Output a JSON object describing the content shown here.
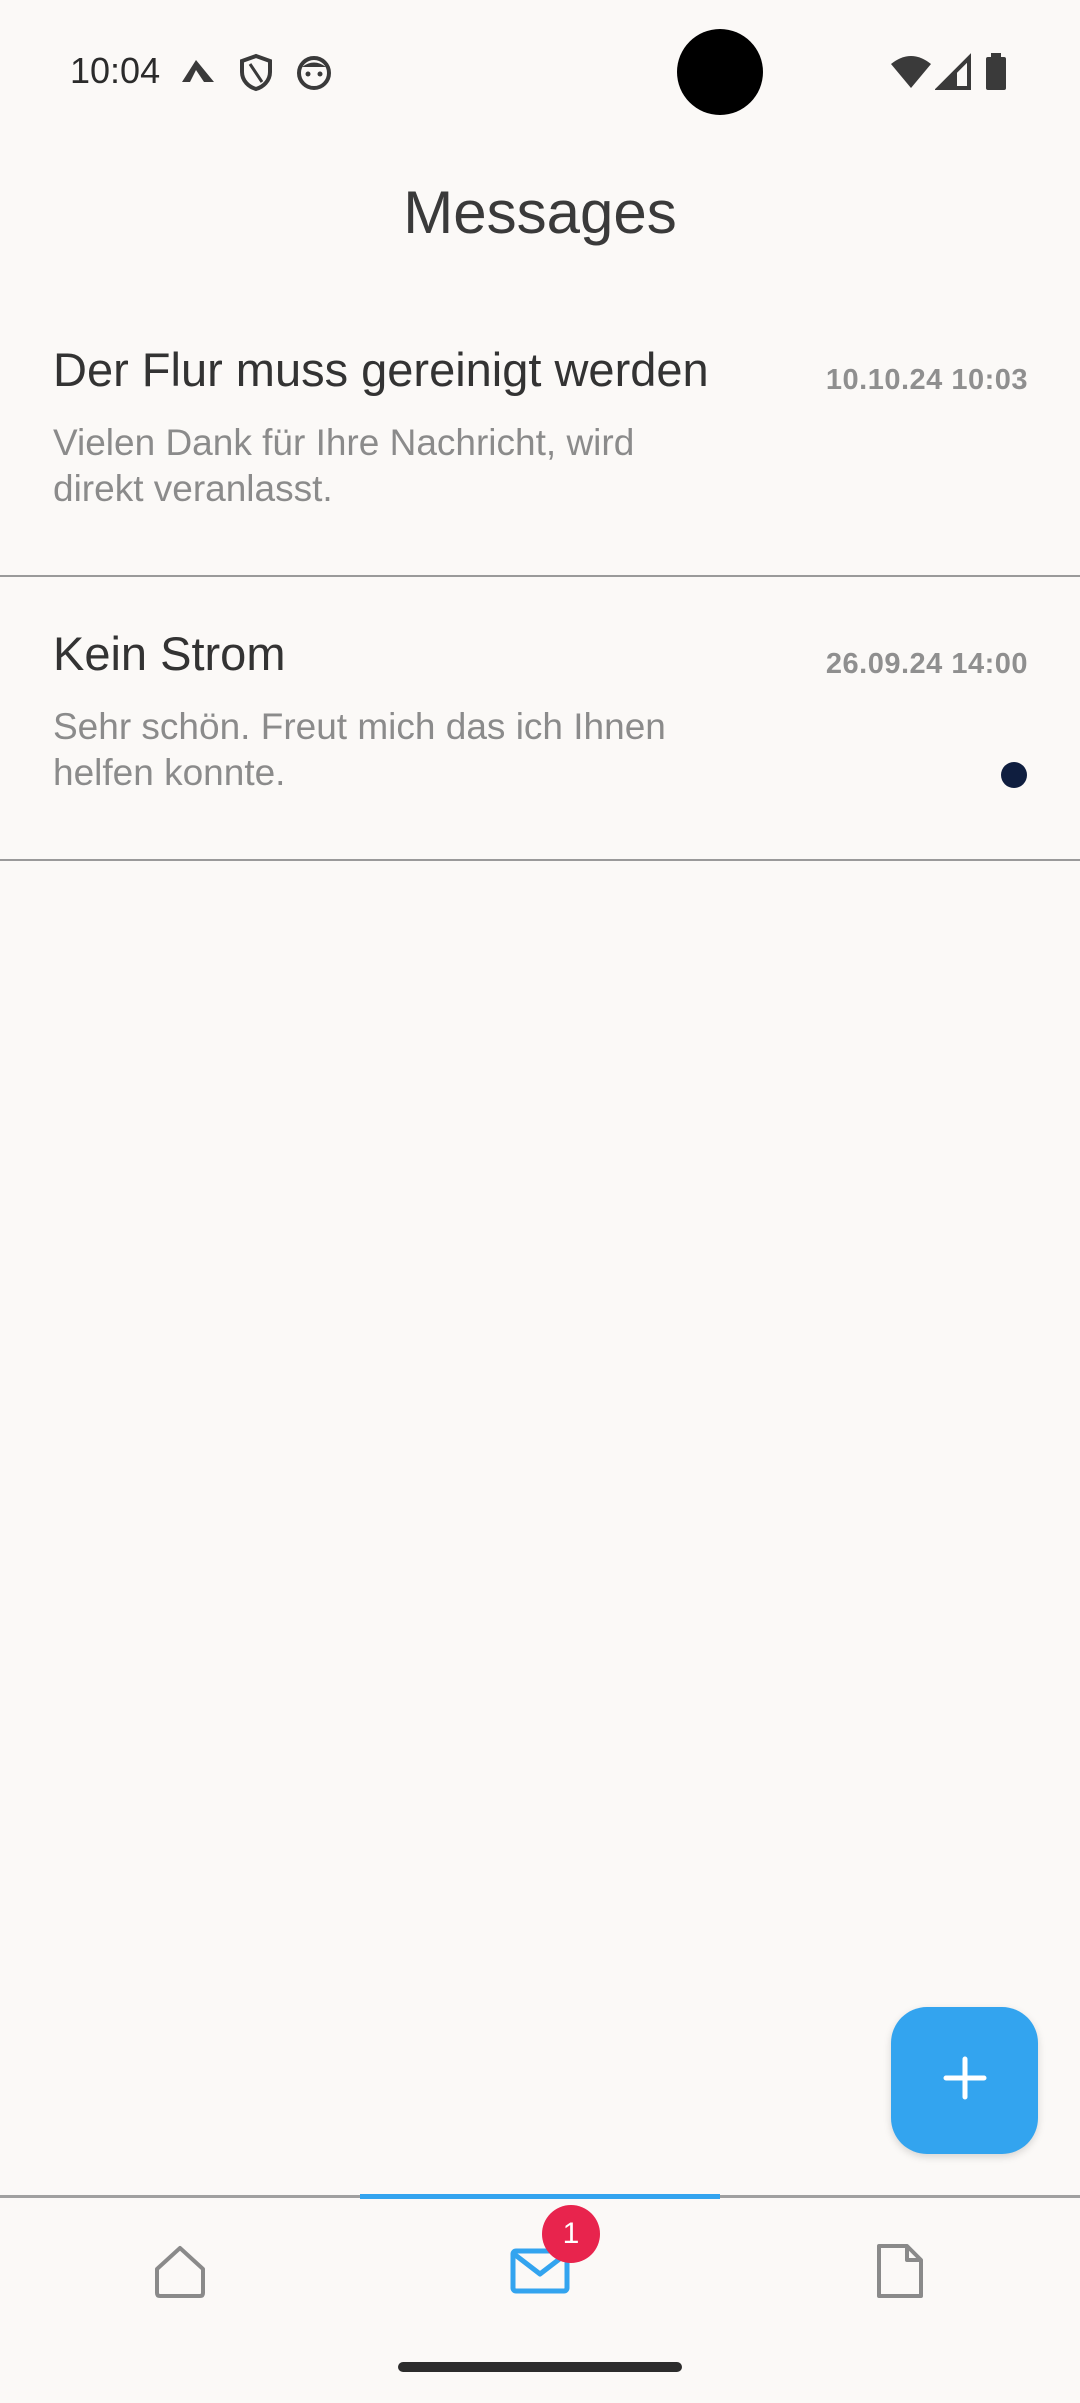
{
  "status_bar": {
    "time": "10:04",
    "icons": [
      "navigation-arrow-icon",
      "shield-icon",
      "face-icon",
      "wifi-icon",
      "cellular-signal-icon",
      "battery-icon"
    ]
  },
  "page": {
    "title": "Messages"
  },
  "messages": [
    {
      "title": "Der Flur muss gereinigt werden",
      "preview": "Vielen Dank für Ihre Nachricht, wird direkt veranlasst.",
      "date": "10.10.24 10:03",
      "unread": false
    },
    {
      "title": "Kein Strom",
      "preview": "Sehr schön. Freut mich das ich Ihnen helfen konnte.",
      "date": "26.09.24 14:00",
      "unread": true
    }
  ],
  "fab": {
    "icon": "plus-icon"
  },
  "bottom_nav": {
    "items": [
      {
        "icon": "home-icon",
        "active": false
      },
      {
        "icon": "mail-icon",
        "active": true,
        "badge": "1"
      },
      {
        "icon": "document-icon",
        "active": false
      }
    ]
  },
  "colors": {
    "accent": "#33a4ef",
    "badge": "#e8244d",
    "unread_dot": "#0f1e3f",
    "background": "#fbf9f7"
  }
}
